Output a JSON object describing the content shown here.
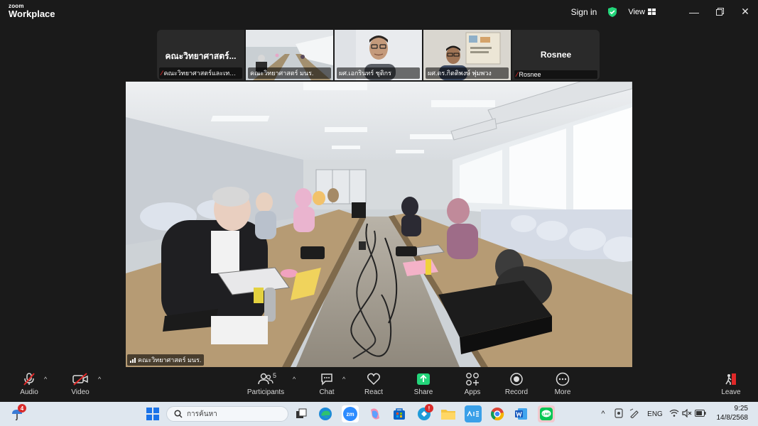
{
  "app": {
    "logo_line1": "zoom",
    "logo_line2": "Workplace",
    "signin_label": "Sign in",
    "view_label": "View",
    "accent_green": "#23d57a",
    "mute_red": "#e02828"
  },
  "gallery": {
    "tiles": [
      {
        "bigname": "คณะวิทยาศาสตร์...",
        "caption": "คณะวิทยาศาสตร์และเทคโ..."
      },
      {
        "caption": "คณะวิทยาศาสตร์ มนร."
      },
      {
        "caption": "ผศ.เอกรินทร์ ชุติกร"
      },
      {
        "caption": "ผศ.ดร.กิตติพงษ์ พุ่มพวง"
      },
      {
        "bigname": "Rosnee",
        "caption": "Rosnee"
      }
    ]
  },
  "main_video": {
    "label": "คณะวิทยาศาสตร์ มนร."
  },
  "toolbar": {
    "audio": "Audio",
    "video": "Video",
    "participants": "Participants",
    "participants_count": "5",
    "chat": "Chat",
    "react": "React",
    "share": "Share",
    "apps": "Apps",
    "record": "Record",
    "more": "More",
    "leave": "Leave"
  },
  "taskbar": {
    "weather_badge": "4",
    "search_placeholder": "การค้นหา",
    "notif_badge": "!",
    "lang": "ENG",
    "time": "9:25",
    "date": "14/8/2568"
  }
}
